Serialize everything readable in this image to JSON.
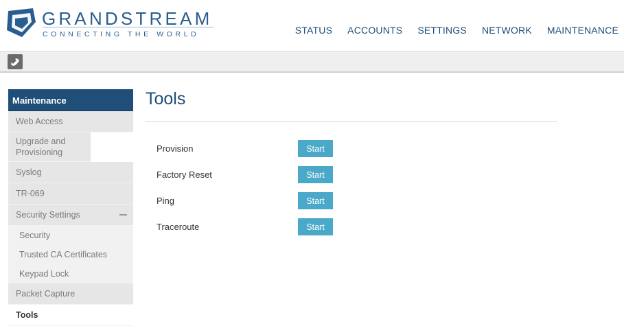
{
  "brand": {
    "name": "GRANDSTREAM",
    "tagline": "CONNECTING THE WORLD"
  },
  "topnav": [
    {
      "label": "STATUS"
    },
    {
      "label": "ACCOUNTS"
    },
    {
      "label": "SETTINGS"
    },
    {
      "label": "NETWORK"
    },
    {
      "label": "MAINTENANCE"
    }
  ],
  "toolbar": {
    "icon": "phone-handset-icon"
  },
  "sidebar": {
    "header": "Maintenance",
    "items": [
      {
        "label": "Web Access"
      },
      {
        "label": "Upgrade and Provisioning"
      },
      {
        "label": "Syslog"
      },
      {
        "label": "TR-069"
      },
      {
        "label": "Security Settings"
      },
      {
        "label": "Security"
      },
      {
        "label": "Trusted CA Certificates"
      },
      {
        "label": "Keypad Lock"
      },
      {
        "label": "Packet Capture"
      },
      {
        "label": "Tools"
      }
    ]
  },
  "main": {
    "title": "Tools",
    "tools": [
      {
        "label": "Provision",
        "button": "Start"
      },
      {
        "label": "Factory Reset",
        "button": "Start"
      },
      {
        "label": "Ping",
        "button": "Start"
      },
      {
        "label": "Traceroute",
        "button": "Start"
      }
    ]
  },
  "colors": {
    "brand_blue": "#1f4e79",
    "button_teal": "#4aa8c9"
  }
}
